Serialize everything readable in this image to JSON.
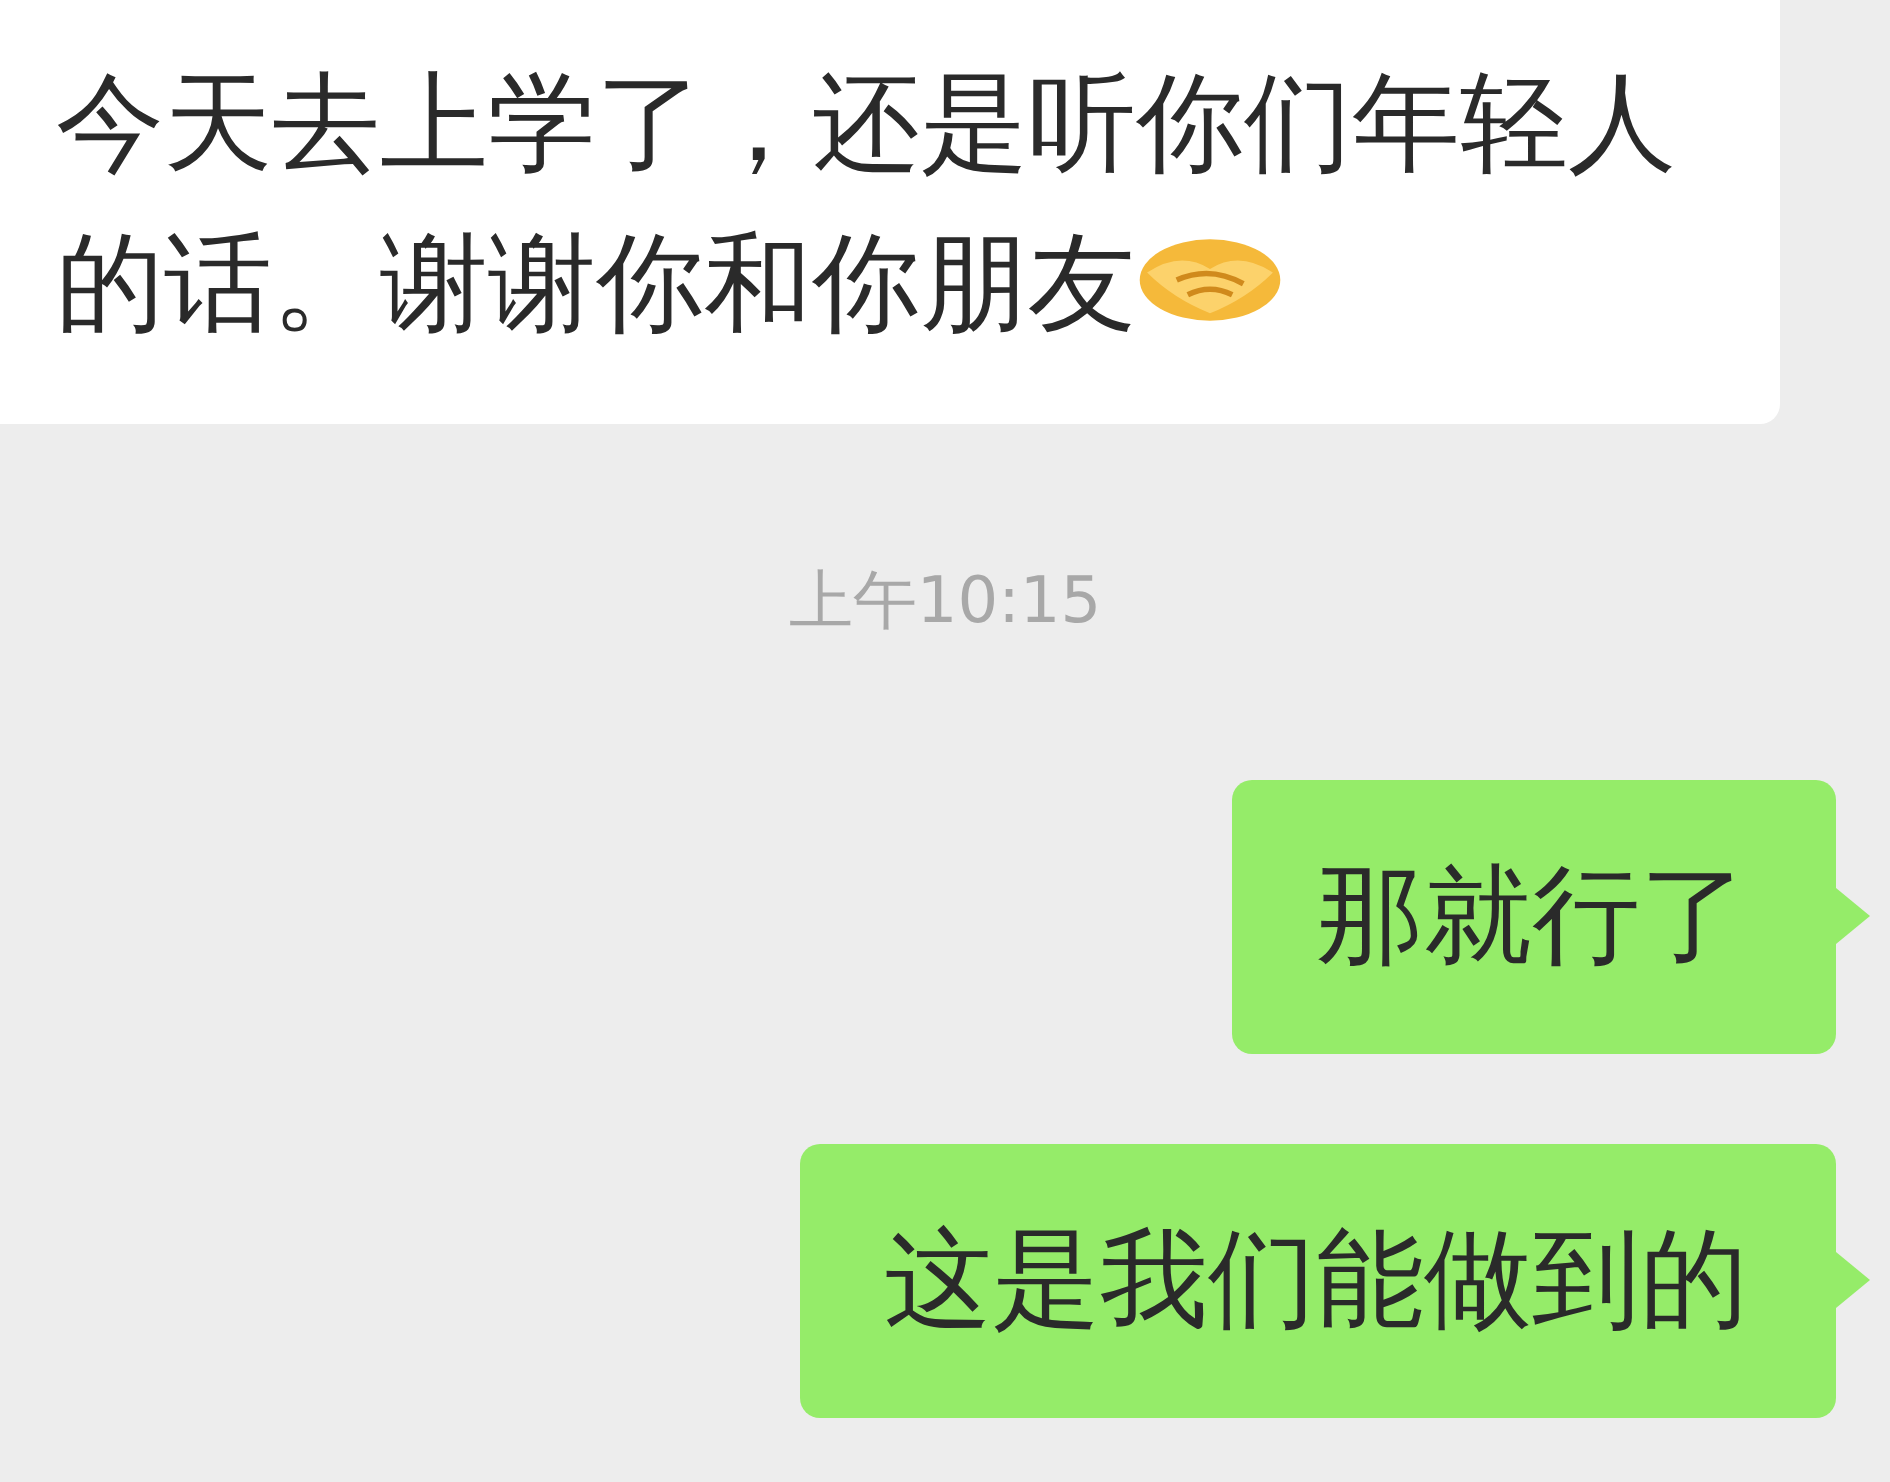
{
  "messages": [
    {
      "kind": "received",
      "text": "今天去上学了，还是听你们年轻人的话。谢谢你和你朋友"
    },
    {
      "kind": "time",
      "text": "上午10:15"
    },
    {
      "kind": "sent",
      "text": "那就行了"
    },
    {
      "kind": "sent",
      "text": "这是我们能做到的"
    }
  ]
}
